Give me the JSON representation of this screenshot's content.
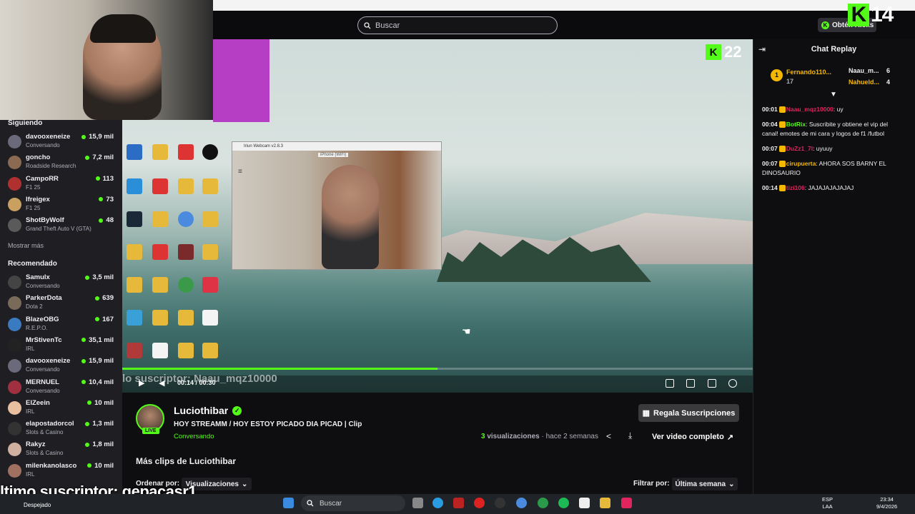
{
  "header": {
    "search_placeholder": "Buscar",
    "get_kicks_label": "Obtén Kicks",
    "counter_top": "14"
  },
  "player": {
    "overlay_counter": "22",
    "sub_ticker": "lo suscriptor: Naau_mqz10000",
    "time": "00:14 / 00:30",
    "progress": 0.5,
    "webcam_window_title": "Iriun Webcam v2.8.3",
    "webcam_device": "iPhone (WiFi)"
  },
  "sidebar": {
    "following_title": "Siguiendo",
    "following": [
      {
        "name": "davooxeneize",
        "category": "Conversando",
        "viewers": "15,9 mil",
        "color": "#6a6a7a"
      },
      {
        "name": "goncho",
        "category": "Roadside Research",
        "viewers": "7,2 mil",
        "color": "#8a6a50"
      },
      {
        "name": "CampoRR",
        "category": "F1 25",
        "viewers": "113",
        "color": "#b03030"
      },
      {
        "name": "lfreigex",
        "category": "F1 25",
        "viewers": "73",
        "color": "#c9a060"
      },
      {
        "name": "ShotByWolf",
        "category": "Grand Theft Auto V (GTA)",
        "viewers": "48",
        "color": "#5a5a5a"
      }
    ],
    "show_more": "Mostrar más",
    "recommended_title": "Recomendado",
    "recommended": [
      {
        "name": "Samulx",
        "category": "Conversando",
        "viewers": "3,5 mil",
        "color": "#444"
      },
      {
        "name": "ParkerDota",
        "category": "Dota 2",
        "viewers": "639",
        "color": "#7a6a5a"
      },
      {
        "name": "BlazeOBG",
        "category": "R.E.P.O.",
        "viewers": "167",
        "color": "#3a7ac0"
      },
      {
        "name": "MrStivenTc",
        "category": "IRL",
        "viewers": "35,1 mil",
        "color": "#222"
      },
      {
        "name": "davooxeneize",
        "category": "Conversando",
        "viewers": "15,9 mil",
        "color": "#6a6a7a"
      },
      {
        "name": "MERNUEL",
        "category": "Conversando",
        "viewers": "10,4 mil",
        "color": "#a03040"
      },
      {
        "name": "ElZeein",
        "category": "IRL",
        "viewers": "10 mil",
        "color": "#e8c0a0"
      },
      {
        "name": "elapostadorcol",
        "category": "Slots & Casino",
        "viewers": "1,3 mil",
        "color": "#333"
      },
      {
        "name": "Rakyz",
        "category": "Slots & Casino",
        "viewers": "1,8 mil",
        "color": "#d0b0a0"
      },
      {
        "name": "milenkanolasco",
        "category": "IRL",
        "viewers": "10 mil",
        "color": "#a07060"
      }
    ]
  },
  "clip": {
    "channel": "Luciothibar",
    "live_badge": "LIVE",
    "title": "HOY STREAMM / HOY ESTOY PICADO DIA PICAD | Clip",
    "category": "Conversando",
    "gift_button": "Regala Suscripciones",
    "views_count": "3",
    "views_label": "visualizaciones",
    "age": "hace 2 semanas",
    "full_video_button": "Ver video completo",
    "more_clips_title": "Más clips de Luciothibar",
    "order_label": "Ordenar por:",
    "order_value": "Visualizaciones",
    "filter_label": "Filtrar por:",
    "filter_value": "Última semana"
  },
  "chat": {
    "title": "Chat Replay",
    "leaderboard": [
      {
        "rank": "1",
        "name": "Fernando110...",
        "score": "17"
      },
      {
        "name": "Naau_m...",
        "score": "6"
      },
      {
        "name": "Nahueld...",
        "score": "4"
      }
    ],
    "messages": [
      {
        "time": "00:01",
        "user": "Naau_mqz10000",
        "color": "#e0245e",
        "text": ": uy"
      },
      {
        "time": "00:04",
        "user": "BotRix",
        "color": "#53fc18",
        "text": ": Suscribite y obtiene el vip del canal! emotes de mi cara y logos de f1 /futbol"
      },
      {
        "time": "00:07",
        "user": "DuZz1_7l",
        "color": "#e0245e",
        "text": ": uyuuy"
      },
      {
        "time": "00:07",
        "user": "cirupuerta",
        "color": "#f5b800",
        "text": ": AHORA SOS BARNY EL DINOSAURIO"
      },
      {
        "time": "00:14",
        "user": "tizi106",
        "color": "#e0245e",
        "text": ": JAJAJAJAJAJAJ"
      }
    ]
  },
  "overlay": {
    "last_sub": "ltimo suscriptor: gepacasr1",
    "weather": "Despejado"
  },
  "taskbar": {
    "search": "Buscar",
    "lang": "ESP",
    "lang2": "LAA",
    "time": "23:34",
    "date": "9/4/2026"
  }
}
